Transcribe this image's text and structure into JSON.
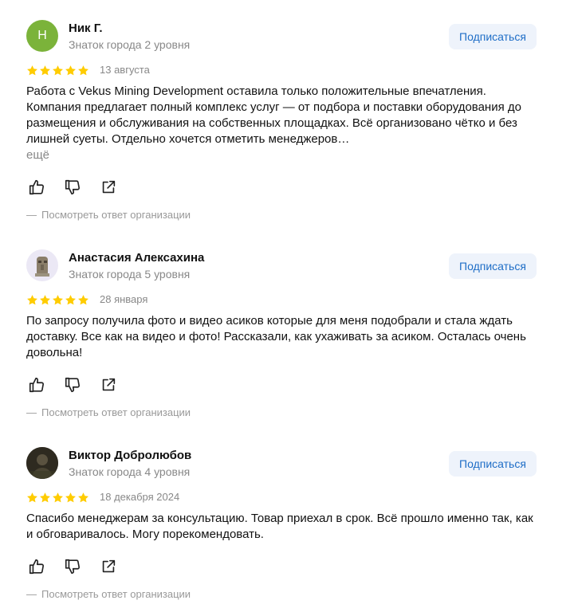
{
  "reviews": [
    {
      "avatar_letter": "Н",
      "author": "Ник Г.",
      "level": "Знаток города 2 уровня",
      "subscribe_label": "Подписаться",
      "rating": 5,
      "date": "13 августа",
      "text": "Работа с Vekus Mining Development оставила только положительные впечатления. Компания предлагает полный комплекс услуг — от подбора и поставки оборудования до размещения и обслуживания на собственных площадках. Всё организовано чётко и без лишней суеты. Отдельно хочется отметить менеджеров…",
      "more_label": "ещё",
      "org_answer_label": "Посмотреть ответ организации"
    },
    {
      "avatar_letter": "",
      "author": "Анастасия Алексахина",
      "level": "Знаток города 5 уровня",
      "subscribe_label": "Подписаться",
      "rating": 5,
      "date": "28 января",
      "text": "По запросу получила фото и видео асиков которые для меня подобрали и стала ждать доставку. Все как на видео и фото! Рассказали, как ухаживать за асиком. Осталась очень довольна!",
      "more_label": "",
      "org_answer_label": "Посмотреть ответ организации"
    },
    {
      "avatar_letter": "",
      "author": "Виктор Добролюбов",
      "level": "Знаток города 4 уровня",
      "subscribe_label": "Подписаться",
      "rating": 5,
      "date": "18 декабря 2024",
      "text": "Спасибо менеджерам за консультацию. Товар приехал в срок. Всё прошло именно так, как и обговаривалось. Могу порекомендовать.",
      "more_label": "",
      "org_answer_label": "Посмотреть ответ организации"
    }
  ],
  "org_dash": "—",
  "colors": {
    "star": "#fc0",
    "subscribe_bg": "#eef3fb",
    "subscribe_text": "#1f6ec7",
    "avatar_green": "#7bb33a"
  },
  "icons": [
    "like-icon",
    "dislike-icon",
    "share-icon"
  ]
}
